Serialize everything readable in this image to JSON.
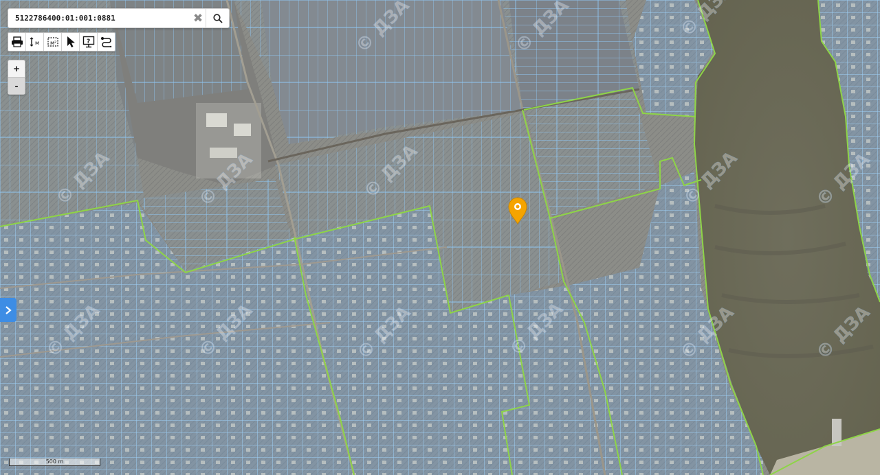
{
  "search": {
    "value": "5122786400:01:001:0881",
    "clear_icon": "close-icon",
    "search_icon": "search-icon"
  },
  "toolbar": {
    "tools": [
      {
        "icon": "print-icon"
      },
      {
        "icon": "measure-distance-icon"
      },
      {
        "icon": "measure-area-icon"
      },
      {
        "icon": "select-pointer-icon"
      },
      {
        "icon": "identify-info-icon"
      },
      {
        "icon": "layers-switch-icon"
      }
    ]
  },
  "zoom": {
    "in_label": "+",
    "out_label": "-"
  },
  "side_panel": {
    "icon": "chevron-right-icon"
  },
  "scale": {
    "label": "500 m"
  },
  "watermark": {
    "text": "© ДЗА"
  },
  "marker": {
    "icon": "location-pin-icon",
    "color": "#f5a400"
  },
  "colors": {
    "parcel_outline": "#8fc6f2",
    "boundary_line": "#8ed447",
    "water": "#6b6a57",
    "marker": "#f5a400",
    "panel_button": "#3d8de5"
  }
}
